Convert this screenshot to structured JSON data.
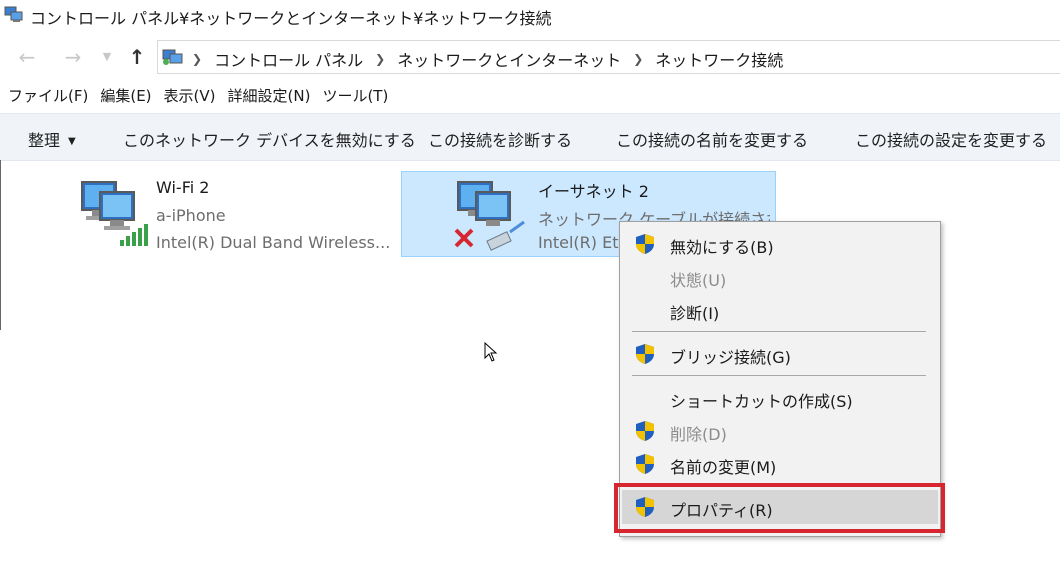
{
  "window": {
    "title": "コントロール パネル¥ネットワークとインターネット¥ネットワーク接続"
  },
  "nav": {
    "back_icon": "arrow-left-icon",
    "forward_icon": "arrow-right-icon",
    "recent_icon": "chevron-down-icon",
    "up_icon": "arrow-up-icon",
    "breadcrumbs": [
      "コントロール パネル",
      "ネットワークとインターネット",
      "ネットワーク接続"
    ]
  },
  "menubar": {
    "items": [
      "ファイル(F)",
      "編集(E)",
      "表示(V)",
      "詳細設定(N)",
      "ツール(T)"
    ]
  },
  "commandbar": {
    "organize": "整理",
    "disable": "このネットワーク デバイスを無効にする",
    "diagnose": "この接続を診断する",
    "rename": "この接続の名前を変更する",
    "settings": "この接続の設定を変更する"
  },
  "connections": [
    {
      "name": "Wi-Fi 2",
      "status": "a-iPhone",
      "device": "Intel(R) Dual Band Wireless...",
      "icon": "wifi-network-icon"
    },
    {
      "name": "イーサネット 2",
      "status": "ネットワーク ケーブルが接続され...",
      "device": "Intel(R) Eth",
      "icon": "ethernet-disconnected-icon",
      "selected": true
    }
  ],
  "context_menu": {
    "items": [
      {
        "label": "無効にする(B)",
        "shield": true,
        "disabled": false
      },
      {
        "label": "状態(U)",
        "shield": false,
        "disabled": true
      },
      {
        "label": "診断(I)",
        "shield": false,
        "disabled": false
      },
      {
        "label": "ブリッジ接続(G)",
        "shield": true,
        "disabled": false
      },
      {
        "label": "ショートカットの作成(S)",
        "shield": false,
        "disabled": false
      },
      {
        "label": "削除(D)",
        "shield": true,
        "disabled": true
      },
      {
        "label": "名前の変更(M)",
        "shield": true,
        "disabled": false
      },
      {
        "label": "プロパティ(R)",
        "shield": true,
        "disabled": false,
        "highlighted": true
      }
    ]
  },
  "colors": {
    "selection_bg": "#cce8ff",
    "selection_border": "#99d1ff",
    "annotation_red": "#d6262f",
    "shield_blue": "#1f5fbf",
    "shield_yellow": "#f2c200"
  }
}
